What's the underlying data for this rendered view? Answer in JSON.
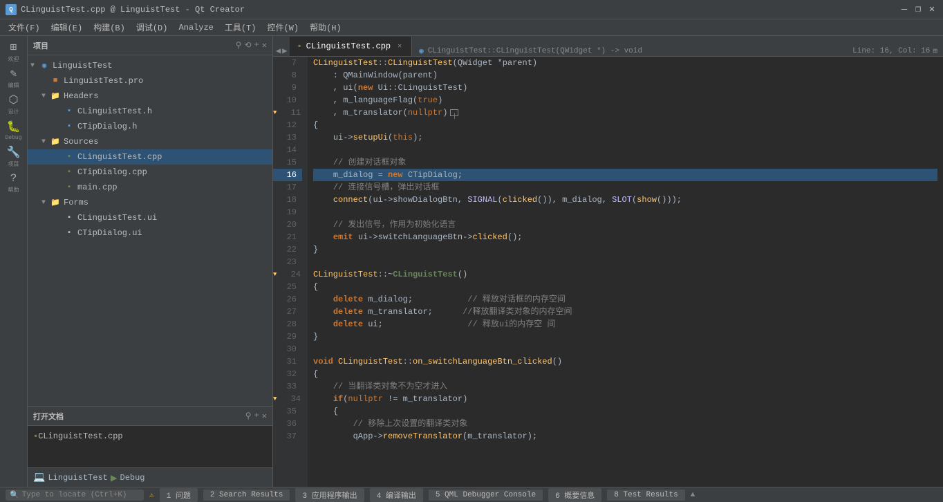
{
  "titleBar": {
    "title": "CLinguistTest.cpp @ LinguistTest - Qt Creator",
    "iconLabel": "Qt"
  },
  "menuBar": {
    "items": [
      "文件(F)",
      "编辑(E)",
      "构建(B)",
      "调试(D)",
      "Analyze",
      "工具(T)",
      "控件(W)",
      "帮助(H)"
    ]
  },
  "fileTree": {
    "title": "项目",
    "rootProject": "LinguistTest",
    "nodes": [
      {
        "level": 0,
        "name": "LinguistTest",
        "type": "project",
        "expanded": true
      },
      {
        "level": 1,
        "name": "LinguistTest.pro",
        "type": "pro"
      },
      {
        "level": 1,
        "name": "Headers",
        "type": "folder",
        "expanded": true
      },
      {
        "level": 2,
        "name": "CLinguistTest.h",
        "type": "header"
      },
      {
        "level": 2,
        "name": "CTipDialog.h",
        "type": "header"
      },
      {
        "level": 1,
        "name": "Sources",
        "type": "folder",
        "expanded": true
      },
      {
        "level": 2,
        "name": "CLinguistTest.cpp",
        "type": "cpp",
        "selected": true
      },
      {
        "level": 2,
        "name": "CTipDialog.cpp",
        "type": "cpp"
      },
      {
        "level": 2,
        "name": "main.cpp",
        "type": "cpp"
      },
      {
        "level": 1,
        "name": "Forms",
        "type": "folder",
        "expanded": true
      },
      {
        "level": 2,
        "name": "CLinguistTest.ui",
        "type": "ui"
      },
      {
        "level": 2,
        "name": "CTipDialog.ui",
        "type": "ui"
      }
    ]
  },
  "openDocs": {
    "title": "打开文档",
    "items": [
      "CLinguistTest.cpp"
    ]
  },
  "deviceStrip": {
    "projectName": "LinguistTest",
    "label": "Debug"
  },
  "editorTabs": {
    "tabs": [
      {
        "label": "CLinguistTest.cpp",
        "active": true,
        "modified": false
      },
      {
        "label": "",
        "active": false
      }
    ],
    "breadcrumb": "CLinguistTest::CLinguistTest(QWidget *) -> void",
    "position": "Line: 16, Col: 16"
  },
  "codeLines": [
    {
      "num": 7,
      "content": "CLinguistTest::CLinguistTest(QWidget *parent)",
      "highlight": false
    },
    {
      "num": 8,
      "content": "    : QMainWindow(parent)",
      "highlight": false
    },
    {
      "num": 9,
      "content": "    , ui(new Ui::CLinguistTest)",
      "highlight": false
    },
    {
      "num": 10,
      "content": "    , m_languageFlag(true)",
      "highlight": false
    },
    {
      "num": 11,
      "content": "    , m_translator(nullptr)",
      "highlight": false,
      "arrow": true
    },
    {
      "num": 12,
      "content": "{",
      "highlight": false
    },
    {
      "num": 13,
      "content": "    ui->setupUi(this);",
      "highlight": false
    },
    {
      "num": 14,
      "content": "",
      "highlight": false
    },
    {
      "num": 15,
      "content": "    // 创建对话框对象",
      "highlight": false
    },
    {
      "num": 16,
      "content": "    m_dialog = new CTipDialog;",
      "highlight": true
    },
    {
      "num": 17,
      "content": "    // 连接信号槽，弹出对话框",
      "highlight": false
    },
    {
      "num": 18,
      "content": "    connect(ui->showDialogBtn, SIGNAL(clicked()), m_dialog, SLOT(show()));",
      "highlight": false
    },
    {
      "num": 19,
      "content": "",
      "highlight": false
    },
    {
      "num": 20,
      "content": "    // 发出信号，作用为初始化语言",
      "highlight": false
    },
    {
      "num": 21,
      "content": "    emit ui->switchLanguageBtn->clicked();",
      "highlight": false
    },
    {
      "num": 22,
      "content": "}",
      "highlight": false
    },
    {
      "num": 23,
      "content": "",
      "highlight": false
    },
    {
      "num": 24,
      "content": "CLinguistTest::~CLinguistTest()",
      "highlight": false,
      "arrow": true
    },
    {
      "num": 25,
      "content": "{",
      "highlight": false
    },
    {
      "num": 26,
      "content": "    delete m_dialog;          // 释放对话框的内存空间",
      "highlight": false
    },
    {
      "num": 27,
      "content": "    delete m_translator;       //释放翻译类对象的内存空间",
      "highlight": false
    },
    {
      "num": 28,
      "content": "    delete ui;                 // 释放ui的内存空 间",
      "highlight": false
    },
    {
      "num": 29,
      "content": "}",
      "highlight": false
    },
    {
      "num": 30,
      "content": "",
      "highlight": false
    },
    {
      "num": 31,
      "content": "void CLinguistTest::on_switchLanguageBtn_clicked()",
      "highlight": false
    },
    {
      "num": 32,
      "content": "{",
      "highlight": false
    },
    {
      "num": 33,
      "content": "    // 当翻译类对象不为空才进入",
      "highlight": false
    },
    {
      "num": 34,
      "content": "    if(nullptr != m_translator)",
      "highlight": false,
      "arrow": true
    },
    {
      "num": 35,
      "content": "    {",
      "highlight": false
    },
    {
      "num": 36,
      "content": "        // 移除上次设置的翻译类对象",
      "highlight": false
    },
    {
      "num": 37,
      "content": "        qApp->removeTranslator(m_translator);",
      "highlight": false
    }
  ],
  "statusBar": {
    "items": [
      {
        "label": "1 问题",
        "icon": "warning"
      },
      {
        "label": "2 Search Results"
      },
      {
        "label": "3 应用程序输出"
      },
      {
        "label": "4 编译输出"
      },
      {
        "label": "5 QML Debugger Console"
      },
      {
        "label": "6 概要信息"
      },
      {
        "label": "8 Test Results"
      }
    ],
    "locateLabel": "Type to locate (Ctrl+K)"
  },
  "leftIcons": [
    {
      "sym": "≡",
      "label": "欢迎"
    },
    {
      "sym": "✎",
      "label": "编辑"
    },
    {
      "sym": "🔨",
      "label": "设计"
    },
    {
      "sym": "🐞",
      "label": "Debug"
    },
    {
      "sym": "🔧",
      "label": "项目"
    },
    {
      "sym": "?",
      "label": "帮助"
    }
  ]
}
